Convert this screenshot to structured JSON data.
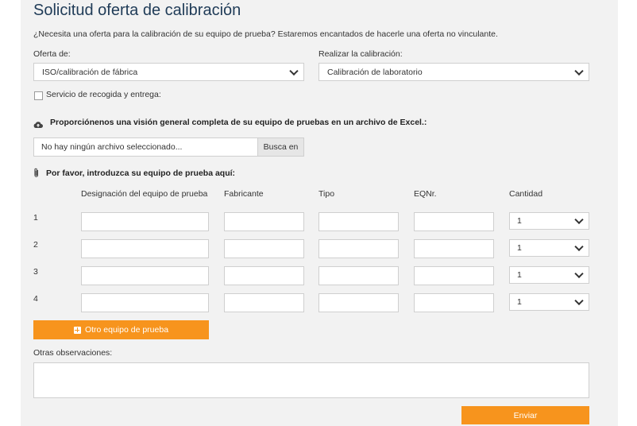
{
  "page": {
    "title": "Solicitud oferta de calibración",
    "intro": "¿Necesita una oferta para la calibración de su equipo de prueba? Estaremos encantados de hacerle una oferta no vinculante."
  },
  "offer": {
    "label": "Oferta de:",
    "selected": "ISO/calibración de fábrica"
  },
  "calibration": {
    "label": "Realizar la calibración:",
    "selected": "Calibración de laboratorio"
  },
  "pickup": {
    "label": "Servicio de recogida y entrega:"
  },
  "excel": {
    "heading": "Proporciónenos una visión general completa de su equipo de pruebas en un archivo de Excel.:",
    "file_status": "No hay ningún archivo seleccionado...",
    "browse_label": "Busca en"
  },
  "equipment": {
    "heading": "Por favor, introduzca su equipo de prueba aquí:",
    "columns": [
      "Designación del equipo de prueba",
      "Fabricante",
      "Tipo",
      "EQNr.",
      "Cantidad"
    ],
    "rows": [
      {
        "num": "1",
        "qty": "1"
      },
      {
        "num": "2",
        "qty": "1"
      },
      {
        "num": "3",
        "qty": "1"
      },
      {
        "num": "4",
        "qty": "1"
      }
    ],
    "add_label": "Otro equipo de prueba"
  },
  "remarks": {
    "label": "Otras observaciones:"
  },
  "submit": {
    "label": "Enviar"
  },
  "colors": {
    "accent": "#f7941d",
    "title": "#1f3b57",
    "panel": "#f2f2f2"
  },
  "icons": [
    "cloud-upload-icon",
    "paperclip-icon",
    "plus-square-icon",
    "chevron-down-icon"
  ]
}
